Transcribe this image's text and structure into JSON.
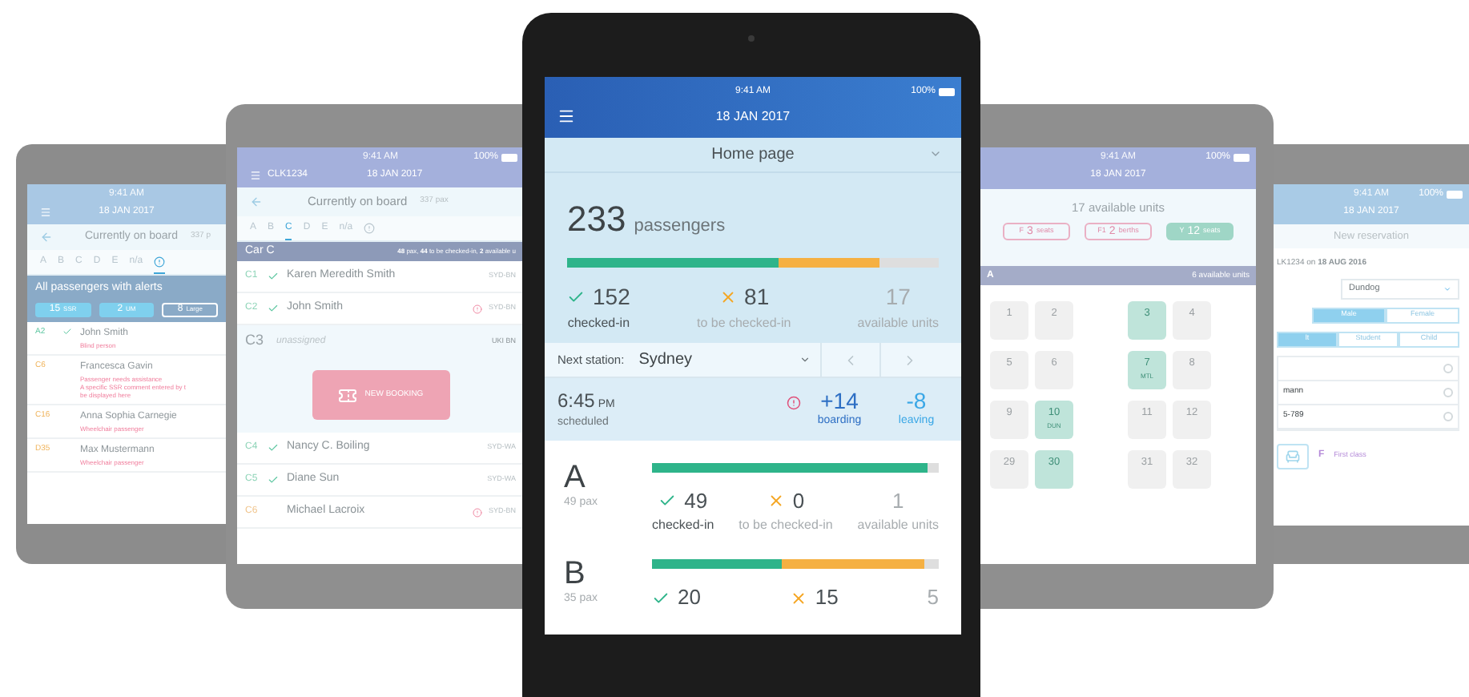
{
  "alerts_tablet": {
    "time": "9:41 AM",
    "date": "18 JAN 2017",
    "title": "Currently on board",
    "count": "337 p",
    "tabs": [
      {
        "kind": "letter",
        "label": "A",
        "selected": false
      },
      {
        "kind": "letter",
        "label": "B",
        "selected": false
      },
      {
        "kind": "letter",
        "label": "C",
        "selected": false
      },
      {
        "kind": "letter",
        "label": "D",
        "selected": false
      },
      {
        "kind": "letter",
        "label": "E",
        "selected": false
      },
      {
        "kind": "letter",
        "label": "n/a",
        "selected": false
      },
      {
        "kind": "alert",
        "selected": true
      }
    ],
    "alerts_heading": "All passengers with alerts",
    "chips": [
      {
        "count": "15",
        "unit": "SSR",
        "selected": true
      },
      {
        "count": "2",
        "unit": "UM",
        "selected": true
      },
      {
        "count": "8",
        "unit": "Large",
        "selected": false
      }
    ],
    "passengers": [
      {
        "seat": "A2",
        "checked": true,
        "name": "John Smith",
        "notes": [
          "Blind person"
        ]
      },
      {
        "seat": "C6",
        "checked": false,
        "name": "Francesca Gavin",
        "notes": [
          "Passenger needs assistance",
          "A specific SSR comment entered by t",
          "be displayed here"
        ]
      },
      {
        "seat": "C16",
        "checked": false,
        "name": "Anna Sophia Carnegie",
        "notes": [
          "Wheelchair passenger"
        ]
      },
      {
        "seat": "D35",
        "checked": false,
        "name": "Max Mustermann",
        "notes": [
          "Wheelchair passenger"
        ]
      }
    ]
  },
  "onboard_tablet": {
    "time": "9:41 AM",
    "battery": "100%",
    "train": "CLK1234",
    "date": "18 JAN 2017",
    "title": "Currently on board",
    "count": "337 pax",
    "tabs": [
      {
        "kind": "letter",
        "label": "A",
        "selected": false
      },
      {
        "kind": "letter",
        "label": "B",
        "selected": false
      },
      {
        "kind": "letter",
        "label": "C",
        "selected": true
      },
      {
        "kind": "letter",
        "label": "D",
        "selected": false
      },
      {
        "kind": "letter",
        "label": "E",
        "selected": false
      },
      {
        "kind": "letter",
        "label": "n/a",
        "selected": false
      },
      {
        "kind": "alert",
        "selected": false
      }
    ],
    "car": "Car C",
    "car_summary": "**48** pax, **44** to be checked-in, **2** available u",
    "rows": [
      {
        "kind": "passenger",
        "seat": "C1",
        "checked": true,
        "name": "Karen Meredith Smith",
        "alert": false,
        "route": "SYD-BN"
      },
      {
        "kind": "passenger",
        "seat": "C2",
        "checked": true,
        "name": "John Smith",
        "alert": true,
        "route": "SYD-BN"
      },
      {
        "kind": "unassigned",
        "seat": "C3",
        "name": "unassigned",
        "route": "UKI BN",
        "action": "NEW BOOKING"
      },
      {
        "kind": "passenger",
        "seat": "C4",
        "checked": true,
        "name": "Nancy C. Boiling",
        "alert": false,
        "route": "SYD-WA"
      },
      {
        "kind": "passenger",
        "seat": "C5",
        "checked": true,
        "name": "Diane Sun",
        "alert": false,
        "route": "SYD-WA"
      },
      {
        "kind": "passenger",
        "seat": "C6",
        "checked": false,
        "name": "Michael Lacroix",
        "alert": true,
        "route": "SYD-BN"
      }
    ]
  },
  "home_tablet": {
    "time": "9:41 AM",
    "battery": "100%",
    "date": "18 JAN 2017",
    "page": "Home page",
    "count": "233",
    "count_unit": "passengers",
    "bar": [
      {
        "kind": "checked",
        "level": 0.57
      },
      {
        "kind": "pending",
        "level": 0.84
      }
    ],
    "stats": [
      {
        "kind": "checked",
        "value": "152",
        "label": "checked-in"
      },
      {
        "kind": "pending",
        "value": "81",
        "label": "to be checked-in"
      },
      {
        "kind": "available",
        "value": "17",
        "label": "available units"
      }
    ],
    "next_station_label": "Next station:",
    "next_station": "Sydney",
    "departure_time": "6:45",
    "departure_period": "PM",
    "departure_note": "scheduled",
    "boarding": {
      "value": "+14",
      "label": "boarding",
      "alert": true
    },
    "leaving": {
      "value": "-8",
      "label": "leaving"
    },
    "cars": [
      {
        "letter": "A",
        "pax": "49 pax",
        "bar": [
          {
            "kind": "checked",
            "level": 0.96
          }
        ],
        "stats": [
          {
            "kind": "checked",
            "value": "49",
            "label": "checked-in"
          },
          {
            "kind": "pending",
            "value": "0",
            "label": "to be checked-in"
          },
          {
            "kind": "available",
            "value": "1",
            "label": "available units"
          }
        ]
      },
      {
        "letter": "B",
        "pax": "35 pax",
        "bar": [
          {
            "kind": "checked",
            "level": 0.45
          },
          {
            "kind": "pending",
            "level": 0.95
          }
        ],
        "stats": [
          {
            "kind": "checked",
            "value": "20"
          },
          {
            "kind": "pending",
            "value": "15"
          },
          {
            "kind": "available",
            "value": "5"
          }
        ]
      }
    ]
  },
  "seats_tablet": {
    "time": "9:41 AM",
    "battery": "100%",
    "date": "18 JAN 2017",
    "title": "17 available units",
    "chips": [
      {
        "fare": "F",
        "count": "3",
        "unit": "seats",
        "selected": false
      },
      {
        "fare": "F1",
        "count": "2",
        "unit": "berths",
        "selected": false
      },
      {
        "fare": "Y",
        "count": "12",
        "unit": "seats",
        "selected": true
      }
    ],
    "car": "A",
    "car_summary": "6 available units",
    "seat_rows": [
      [
        {
          "number": "1",
          "available": false
        },
        {
          "number": "2",
          "available": false
        },
        {
          "number": "3",
          "available": true
        },
        {
          "number": "4",
          "available": false
        }
      ],
      [
        {
          "number": "5",
          "available": false
        },
        {
          "number": "6",
          "available": false
        },
        {
          "number": "7",
          "available": true,
          "station": "MTL"
        },
        {
          "number": "8",
          "available": false
        }
      ],
      [
        {
          "number": "9",
          "available": false
        },
        {
          "number": "10",
          "available": true,
          "station": "DUN"
        },
        {
          "number": "11",
          "available": false
        },
        {
          "number": "12",
          "available": false
        }
      ],
      [
        {
          "number": "29",
          "available": false
        },
        {
          "number": "30",
          "available": true
        },
        {
          "number": "31",
          "available": false
        },
        {
          "number": "32",
          "available": false
        }
      ]
    ]
  },
  "reservation_tablet": {
    "time": "9:41 AM",
    "battery": "100%",
    "date": "18 JAN 2017",
    "title": "New reservation",
    "trip": "LK1234 on **18 AUG 2016**",
    "destination": "Dundog",
    "genders": [
      {
        "label": "Male",
        "selected": true
      },
      {
        "label": "Female",
        "selected": false
      }
    ],
    "fares": [
      {
        "label": "lt",
        "selected": true
      },
      {
        "label": "Student",
        "selected": false
      },
      {
        "label": "Child",
        "selected": false
      }
    ],
    "fields": [
      {
        "kind": "empty"
      },
      {
        "kind": "filled",
        "value": "mann"
      },
      {
        "kind": "filled",
        "value": "5-789"
      }
    ],
    "class_code": "F",
    "class_name": "First class"
  }
}
